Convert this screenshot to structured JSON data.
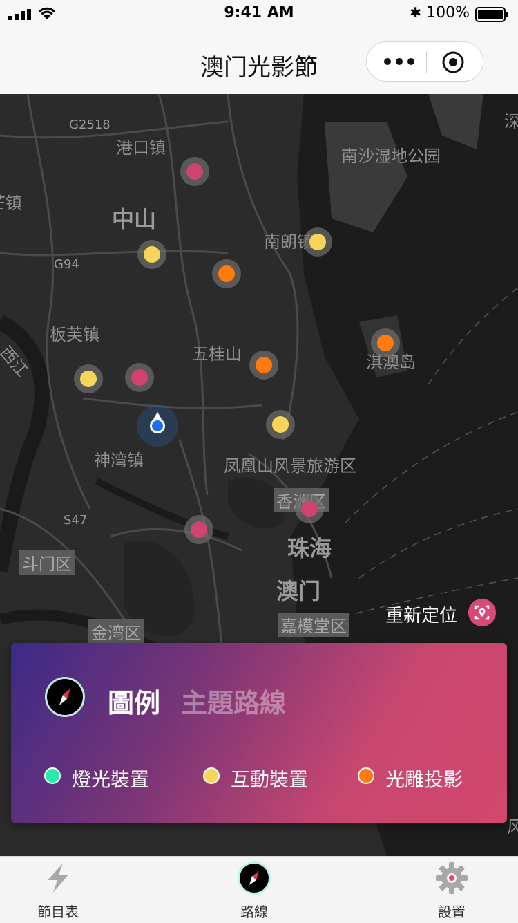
{
  "status_bar": {
    "time": "9:41 AM",
    "battery": "100%"
  },
  "nav": {
    "title": "澳门光影節"
  },
  "map": {
    "places": {
      "g2518": "G2518",
      "gangkou": "港口镇",
      "nansha": "南沙湿地公园",
      "zhen_left": "芒镇",
      "zhongshan": "中山",
      "nanlang": "南朗镇",
      "g94": "G94",
      "banfu": "板芙镇",
      "xijiang": "西江",
      "wuguishan": "五桂山",
      "qiao": "淇澳岛",
      "shenwan": "神湾镇",
      "fenghuang": "凤凰山风景旅游区",
      "xiangzhou": "香洲区",
      "s47": "S47",
      "doumen": "斗门区",
      "zhuhai": "珠海",
      "aomen": "澳门",
      "jiamotang": "嘉模堂区",
      "jinwan": "金湾区",
      "shen_edge": "深",
      "feng_edge": "风乏"
    },
    "relocate_label": "重新定位"
  },
  "legend": {
    "tab_active": "圖例",
    "tab_inactive": "主題路線",
    "items": [
      {
        "label": "燈光裝置",
        "color": "#2ee6b0"
      },
      {
        "label": "互動裝置",
        "color": "#f7d55a"
      },
      {
        "label": "光雕投影",
        "color": "#ff7a0f"
      }
    ]
  },
  "tabbar": {
    "tabs": [
      {
        "label": "節目表",
        "icon": "lightning-icon"
      },
      {
        "label": "路線",
        "icon": "compass-icon"
      },
      {
        "label": "設置",
        "icon": "gear-icon"
      }
    ]
  }
}
